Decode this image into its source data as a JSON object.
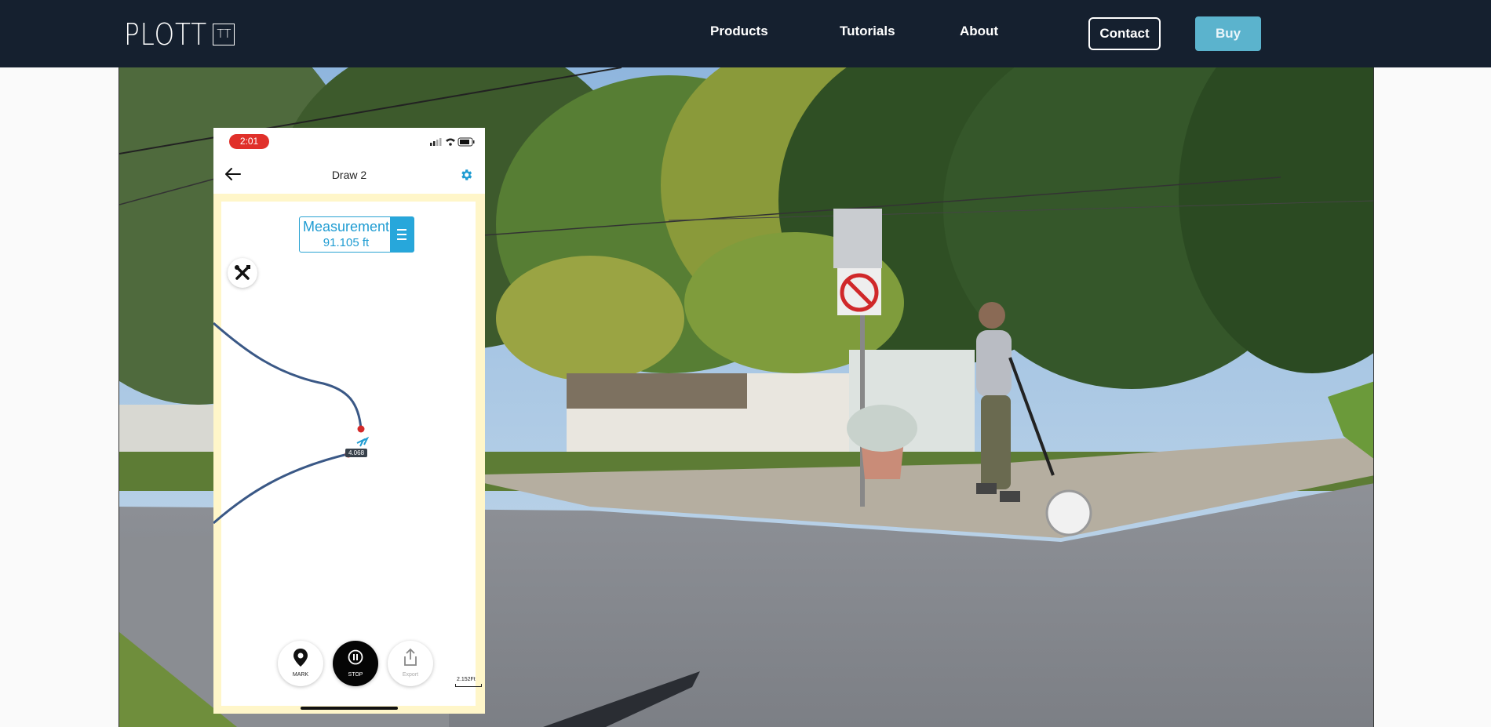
{
  "header": {
    "logo_text": "PLOTT",
    "logo_mark": "TT",
    "nav": {
      "products": "Products",
      "tutorials": "Tutorials",
      "about": "About"
    },
    "contact_label": "Contact",
    "buy_label": "Buy"
  },
  "phone": {
    "status_time": "2:01",
    "title": "Draw 2",
    "measurement_label": "Measurement",
    "measurement_value": "91.105 ft",
    "segment_label": "4.068",
    "controls": {
      "mark": "MARK",
      "stop": "STOP",
      "export": "Export"
    },
    "scale_label": "2.152Ft"
  },
  "colors": {
    "header_bg": "#15202f",
    "buy_button": "#5bb3cd",
    "app_accent": "#1f9cd2",
    "status_time_pill": "#e0302a",
    "path_line": "#3a5886",
    "path_marker": "#d42a2a"
  },
  "icons": {
    "back": "arrow-left-icon",
    "settings": "gear-icon",
    "tools": "wrench-screwdriver-icon",
    "menu": "hamburger-icon",
    "mark": "map-pin-icon",
    "stop": "pause-icon",
    "export": "share-icon"
  }
}
